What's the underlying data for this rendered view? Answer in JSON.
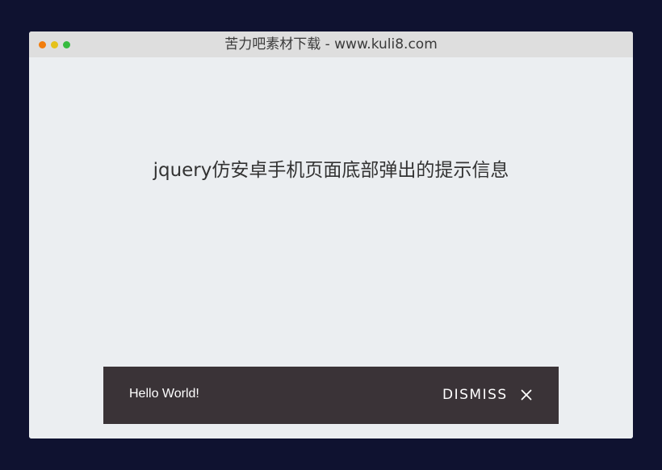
{
  "window": {
    "title": "苦力吧素材下载 - www.kuli8.com"
  },
  "page": {
    "heading": "jquery仿安卓手机页面底部弹出的提示信息"
  },
  "snackbar": {
    "message": "Hello World!",
    "dismiss_label": "DISMISS",
    "close_icon": "close-icon"
  },
  "colors": {
    "outer_background": "#0f1230",
    "page_background": "#ebeef1",
    "titlebar": "#dedede",
    "snackbar_background": "#3a3337",
    "dot_red": "#f27d0c",
    "dot_yellow": "#e5c21b",
    "dot_green": "#36bb3f"
  }
}
